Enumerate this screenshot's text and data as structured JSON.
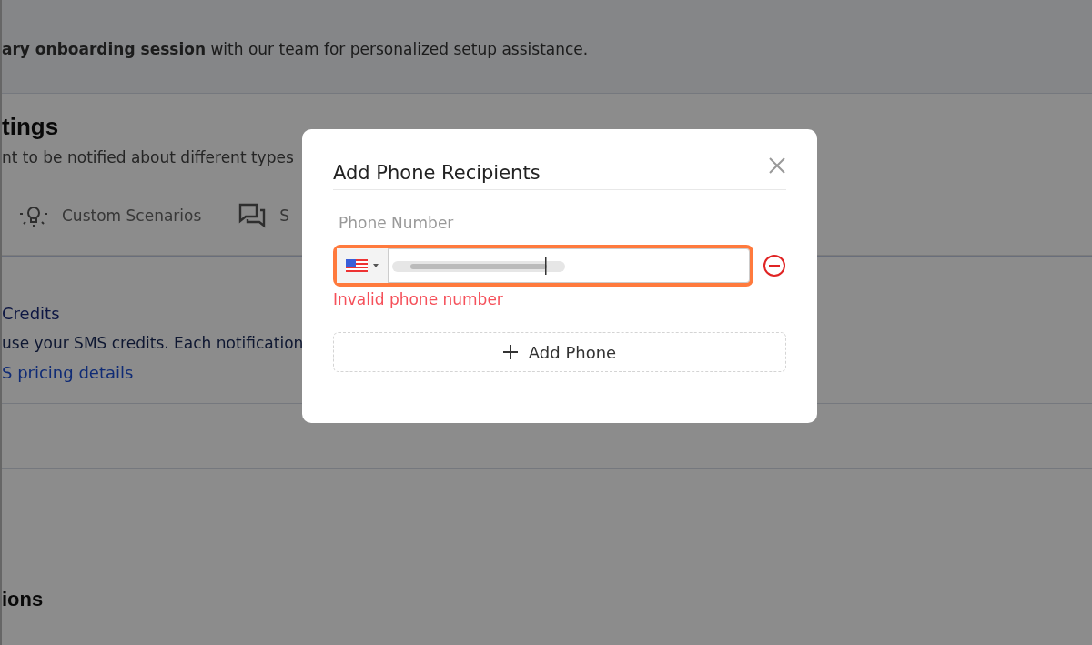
{
  "background": {
    "onboarding_text": "**ary onboarding session** with our team for personalized setup assistance.",
    "settings_title": "tings",
    "settings_subtitle": "nt to be notified about different types",
    "tabs": [
      {
        "label": "Custom Scenarios",
        "kind": "bulb"
      },
      {
        "label": "S",
        "kind": "chat"
      }
    ],
    "credits_title": "Credits",
    "credits_text": "use your SMS credits. Each notification",
    "credits_link": "S pricing details",
    "bottom_title": "ions"
  },
  "dialog": {
    "title": "Add Phone Recipients",
    "field_label": "Phone Number",
    "value_redacted": true,
    "highlighted": true,
    "error": "Invalid phone number",
    "add_button": "Add Phone"
  }
}
